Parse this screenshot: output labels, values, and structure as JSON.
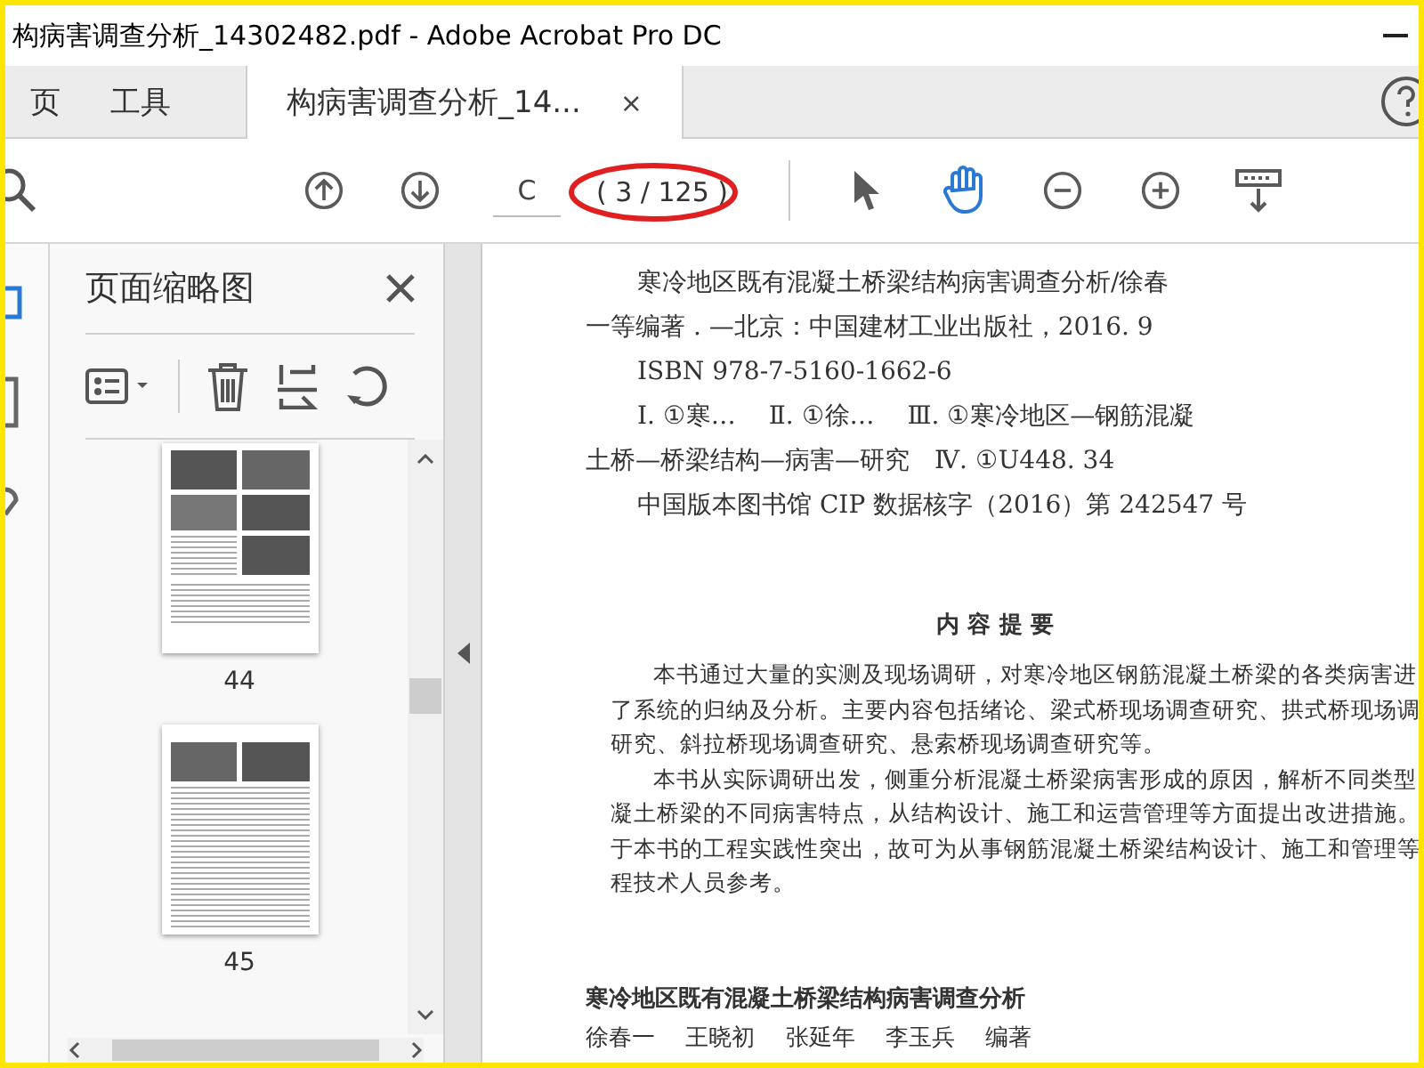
{
  "window": {
    "title": "构病害调查分析_14302482.pdf - Adobe Acrobat Pro DC"
  },
  "tabs": [
    {
      "label": "页",
      "selected": false
    },
    {
      "label": "工具",
      "selected": false
    },
    {
      "label": "构病害调查分析_14...",
      "selected": true,
      "close": "×"
    }
  ],
  "toolbar": {
    "page_field": {
      "value": "C"
    },
    "page_count": "( 3 / 125 )",
    "tools": [
      {
        "kind": "pointer",
        "selected": false
      },
      {
        "kind": "hand",
        "selected": true
      }
    ]
  },
  "sidebar": {
    "title": "页面缩略图",
    "thumbnails": [
      {
        "kind": "photos",
        "page": "44"
      },
      {
        "kind": "text",
        "page": "45"
      }
    ]
  },
  "document": {
    "cip": [
      {
        "indent": true,
        "text": "寒冷地区既有混凝土桥梁结构病害调查分析/徐春"
      },
      {
        "indent": false,
        "text": "一等编著 . —北京：中国建材工业出版社，2016. 9"
      },
      {
        "indent": true,
        "text": "ISBN 978-7-5160-1662-6"
      },
      {
        "indent": true,
        "text": "Ⅰ. ①寒…　 Ⅱ. ①徐…　 Ⅲ. ①寒冷地区—钢筋混凝"
      },
      {
        "indent": false,
        "text": "土桥—桥梁结构—病害—研究　Ⅳ. ①U448. 34"
      },
      {
        "indent": true,
        "text": "中国版本图书馆 CIP 数据核字（2016）第 242547 号"
      }
    ],
    "summary": {
      "title": "内 容 提 要",
      "paragraphs": [
        [
          "本书通过大量的实测及现场调研，对寒冷地区钢筋混凝土桥梁的各类病害进",
          "了系统的归纳及分析。主要内容包括绪论、梁式桥现场调查研究、拱式桥现场调",
          "研究、斜拉桥现场调查研究、悬索桥现场调查研究等。"
        ],
        [
          "本书从实际调研出发，侧重分析混凝土桥梁病害形成的原因，解析不同类型",
          "凝土桥梁的不同病害特点，从结构设计、施工和运营管理等方面提出改进措施。",
          "于本书的工程实践性突出，故可为从事钢筋混凝土桥梁结构设计、施工和管理等",
          "程技术人员参考。"
        ]
      ]
    },
    "footer": {
      "title": "寒冷地区既有混凝土桥梁结构病害调查分析",
      "authors": "徐春一　 王晓初　 张延年　 李玉兵　 编著"
    }
  }
}
